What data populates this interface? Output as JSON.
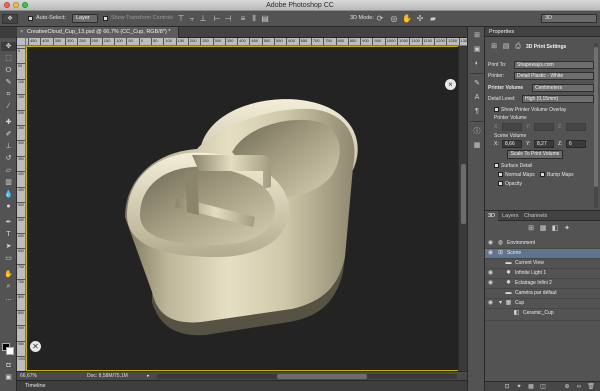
{
  "window": {
    "title": "Adobe Photoshop CC"
  },
  "options_bar": {
    "auto_select_label": "Auto-Select:",
    "auto_select_value": "Layer",
    "show_transform_label": "Show Transform Controls",
    "mode_label": "3D Mode:",
    "workspace_value": "3D"
  },
  "document": {
    "tab_title": "CreativeCloud_Cup_13.psd @ 66,7% (CC_Cup, RGB/8*) *",
    "zoom": "66,67%",
    "doc_info": "Doc: 8,58M/75,1M",
    "ruler_top": [
      "450",
      "400",
      "350",
      "300",
      "250",
      "200",
      "150",
      "100",
      "50",
      "0",
      "50",
      "100",
      "150",
      "200",
      "250",
      "300",
      "350",
      "400",
      "450",
      "500",
      "550",
      "600",
      "650",
      "700",
      "750",
      "800",
      "850",
      "900",
      "950",
      "1000",
      "1050",
      "1100",
      "1150",
      "1200",
      "1250",
      "1300"
    ],
    "ruler_left": [
      "0",
      "50",
      "100",
      "150",
      "200",
      "250",
      "300",
      "350",
      "400",
      "450",
      "500",
      "550",
      "600",
      "650",
      "700",
      "750",
      "800",
      "850",
      "900",
      "950",
      "1000"
    ]
  },
  "timeline": {
    "label": "Timeline"
  },
  "properties": {
    "tab_label": "Properties",
    "section_title": "3D Print Settings",
    "print_to_label": "Print To:",
    "print_to_value": "Shapeways.com",
    "printer_label": "Printer:",
    "printer_value": "Detail Plastic - White",
    "printer_volume_label": "Printer Volume",
    "printer_volume_value": "Centimeters",
    "detail_level_label": "Detail Level:",
    "detail_level_value": "High (0,15mm)",
    "show_overlay_label": "Show Printer Volume Overlay",
    "printer_volume_sub": "Printer Volume",
    "pv_x": "X:",
    "pv_y": "Y:",
    "pv_z": "Z:",
    "scene_volume_label": "Scene Volume",
    "sv_x_label": "X:",
    "sv_x": "8,66",
    "sv_y_label": "Y:",
    "sv_y": "8,27",
    "sv_z_label": "Z:",
    "sv_z": "6",
    "scale_button": "Scale To Print Volume",
    "surface_detail_label": "Surface Detail",
    "normal_maps_label": "Normal Maps",
    "bump_maps_label": "Bump Maps",
    "opacity_label": "Opacity"
  },
  "layers_panel": {
    "tabs": [
      "3D",
      "Layers",
      "Channels"
    ],
    "items": [
      {
        "label": "Environment"
      },
      {
        "label": "Scene"
      },
      {
        "label": "Current View"
      },
      {
        "label": "Infinite Light 1"
      },
      {
        "label": "Eclairage Infini 2"
      },
      {
        "label": "Caméra par défaut"
      },
      {
        "label": "Cup"
      },
      {
        "label": "Ceramic_Cup"
      }
    ]
  },
  "colors": {
    "canvas_bg": "#232323",
    "canvas_border": "#c8b400",
    "cup_base": "#c9c1a2",
    "selection_row": "#5e7590"
  }
}
